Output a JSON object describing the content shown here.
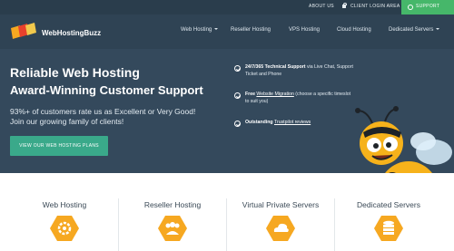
{
  "topbar": {
    "about": "ABOUT US",
    "client_login": "CLIENT LOGIN AREA",
    "support": "SUPPORT"
  },
  "brand": {
    "name": "WebHostingBuzz",
    "accent": "#f6a821"
  },
  "nav": {
    "items": [
      {
        "label": "Web Hosting",
        "dropdown": true
      },
      {
        "label": "Reseller Hosting",
        "dropdown": false
      },
      {
        "label": "VPS Hosting",
        "dropdown": false
      },
      {
        "label": "Cloud Hosting",
        "dropdown": false
      },
      {
        "label": "Dedicated Servers",
        "dropdown": true
      }
    ]
  },
  "hero": {
    "title": "Reliable Web Hosting",
    "subtitle": "Award-Winning Customer Support",
    "line1": "93%+ of customers rate us as Excellent or Very Good!",
    "line2": "Join our growing family of clients!",
    "cta": "VIEW OUR WEB HOSTING PLANS",
    "cta_color": "#3aa98a"
  },
  "features": [
    {
      "bold": "24/7/365 Technical Support",
      "rest": " via Live Chat, Support Ticket and Phone"
    },
    {
      "bold": "Free ",
      "link": "Website Migration",
      "rest": " (choose a specific timeslot to suit you)"
    },
    {
      "bold": "Outstanding ",
      "link": "Trustpilot reviews",
      "rest": ""
    }
  ],
  "products": [
    {
      "name": "Web Hosting",
      "icon": "gear-icon"
    },
    {
      "name": "Reseller Hosting",
      "icon": "users-icon"
    },
    {
      "name": "Virtual Private Servers",
      "icon": "cloud-icon"
    },
    {
      "name": "Dedicated Servers",
      "icon": "database-icon"
    }
  ]
}
